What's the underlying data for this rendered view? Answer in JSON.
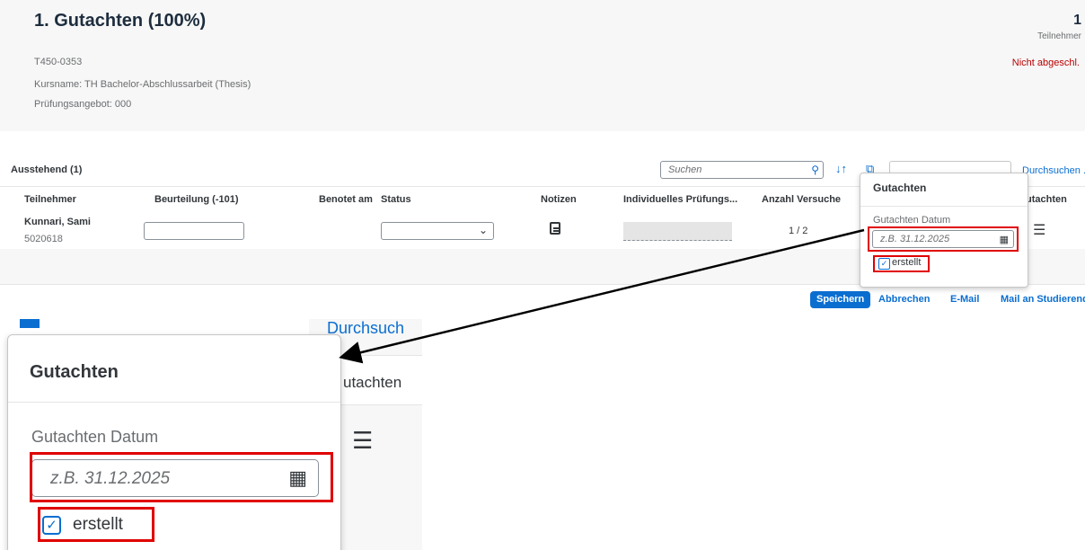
{
  "header": {
    "title": "1. Gutachten (100%)",
    "code": "T450-0353",
    "course": "Kursname: TH Bachelor-Abschlussarbeit (Thesis)",
    "offer": "Prüfungsangebot: 000",
    "participants_count": "1",
    "participants_label": "Teilnehmer",
    "status": "Nicht abgeschl."
  },
  "toolbar": {
    "title": "Ausstehend (1)",
    "search_placeholder": "Suchen",
    "browse_label": "Durchsuchen ..."
  },
  "columns": [
    "Teilnehmer",
    "Beurteilung (-101)",
    "Benotet am",
    "Status",
    "Notizen",
    "Individuelles Prüfungs...",
    "Anzahl Versuche",
    "utachten"
  ],
  "row": {
    "name": "Kunnari, Sami",
    "matrikel": "5020618",
    "attempts": "1 / 2"
  },
  "footer": {
    "save": "Speichern",
    "cancel": "Abbrechen",
    "email": "E-Mail",
    "mail_students": "Mail an Studierend"
  },
  "popover": {
    "title": "Gutachten",
    "date_label": "Gutachten Datum",
    "date_placeholder": "z.B. 31.12.2025",
    "checkbox_label": "erstellt",
    "checkbox_checked": true
  },
  "zoom": {
    "browse_partial": "Durchsuch",
    "column_partial": "utachten"
  },
  "colors": {
    "accent": "#0a6ed1",
    "highlight": "#e00000",
    "status_red": "#bb0000"
  }
}
